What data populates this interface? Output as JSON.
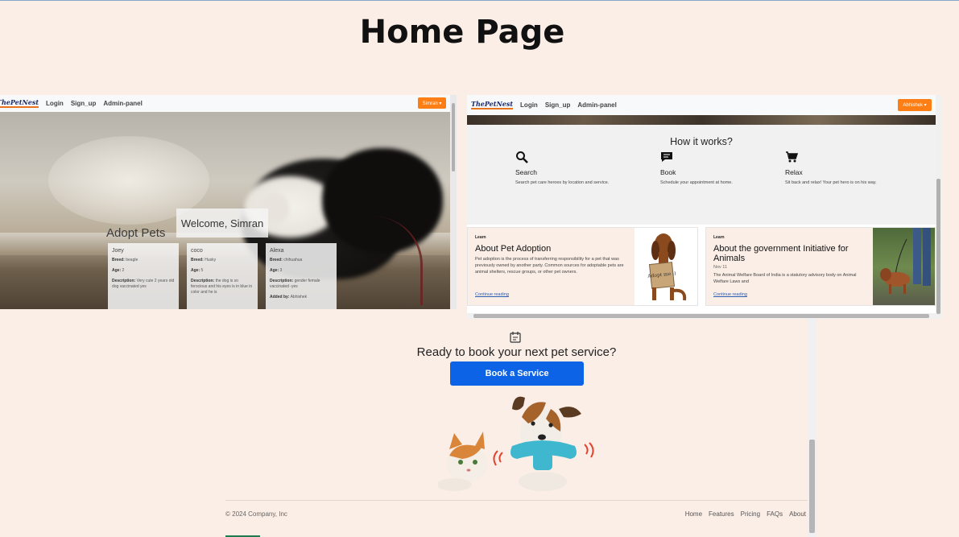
{
  "slide": {
    "title": "Home Page"
  },
  "left_screen": {
    "logo": "ThePetNest",
    "nav": [
      "Login",
      "Sign_up",
      "Admin-panel"
    ],
    "user_button": "Simran ▾",
    "welcome": "Welcome, Simran",
    "section_title": "Adopt Pets",
    "pets": [
      {
        "name": "Joey",
        "breed": "beagle",
        "age": "2",
        "description": "Very cute 2 years old dog vaccinated yes"
      },
      {
        "name": "coco",
        "breed": "Husky",
        "age": "5",
        "description": "the dog is so ferocious and his eyes is in blue in color and he is"
      },
      {
        "name": "Alexa",
        "breed": "chihuahua",
        "age": "3",
        "description": "gender female vaccinated -yes",
        "added_by": "Abhishek"
      }
    ],
    "labels": {
      "breed": "Breed:",
      "age": "Age:",
      "description": "Description:",
      "added_by": "Added by:"
    }
  },
  "right_screen": {
    "logo": "ThePetNest",
    "nav": [
      "Login",
      "Sign_up",
      "Admin-panel"
    ],
    "user_button": "Abhishek ▾",
    "how_it_works": {
      "title": "How it works?",
      "steps": [
        {
          "icon": "search-icon",
          "title": "Search",
          "desc": "Search pet care heroes by location and service."
        },
        {
          "icon": "chat-icon",
          "title": "Book",
          "desc": "Schedule your appointment at home."
        },
        {
          "icon": "cart-icon",
          "title": "Relax",
          "desc": "Sit back and relax! Your pet hero is on his way."
        }
      ]
    },
    "articles": [
      {
        "tag": "Learn",
        "title": "About Pet Adoption",
        "date": "",
        "body": "Pet adoption is the process of transferring responsibility for a pet that was previously owned by another party. Common sources for adoptable pets are animal shelters, rescue groups, or other pet owners.",
        "link": "Continue reading",
        "sign": "Adopt me :)"
      },
      {
        "tag": "Learn",
        "title": "About the government Initiative for Animals",
        "date": "Nov 11",
        "body": "The Animal Welfare Board of India is a statutory advisory body on Animal Welfare Laws and",
        "link": "Continue reading"
      }
    ]
  },
  "bottom": {
    "cta_title": "Ready to book your next pet service?",
    "cta_button": "Book a Service",
    "copyright": "© 2024 Company, Inc",
    "footer_links": [
      "Home",
      "Features",
      "Pricing",
      "FAQs",
      "About"
    ]
  },
  "colors": {
    "accent_orange": "#fd7e14",
    "primary_blue": "#0d63e6",
    "page_bg": "#fbeee6"
  }
}
